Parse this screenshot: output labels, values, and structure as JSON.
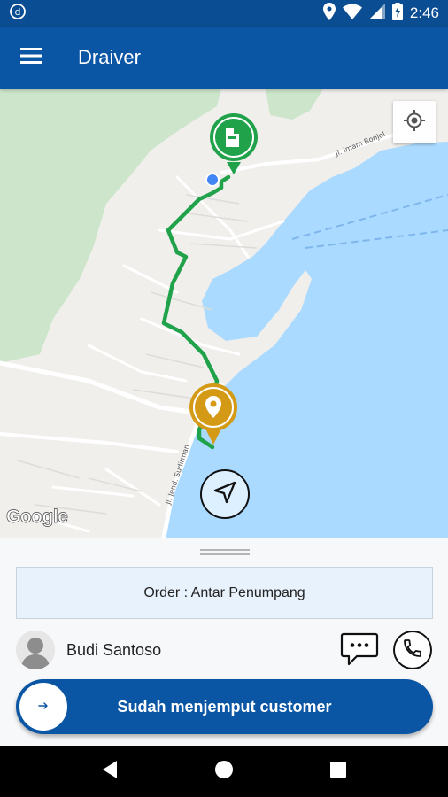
{
  "status_bar": {
    "time": "2:46",
    "icons": [
      "app-notification-icon",
      "location-icon",
      "wifi-icon",
      "signal-icon",
      "battery-charging-icon"
    ]
  },
  "app_bar": {
    "title": "Draiver",
    "menu_icon": "hamburger-menu-icon"
  },
  "map": {
    "street_labels": [
      "Jl. Imam Bonjol",
      "Jl. Jend. Sudirman"
    ],
    "attribution": "Google",
    "colors": {
      "land": "#efefec",
      "green_area": "#cfe8cc",
      "water": "#aadaff",
      "route": "#1fa24a",
      "pickup_pin": "#1fa24a",
      "destination_pin": "#d49a15",
      "current_location": "#4285f4"
    },
    "markers": [
      "pickup-marker",
      "destination-marker",
      "current-location-dot"
    ]
  },
  "panel": {
    "order_text": "Order : Antar Penumpang",
    "customer_name": "Budi Santoso",
    "action_label": "Sudah menjemput customer"
  },
  "colors": {
    "primary": "#0b56a4",
    "status_bar": "#0b4d92",
    "order_box_bg": "#e8f2fd"
  }
}
